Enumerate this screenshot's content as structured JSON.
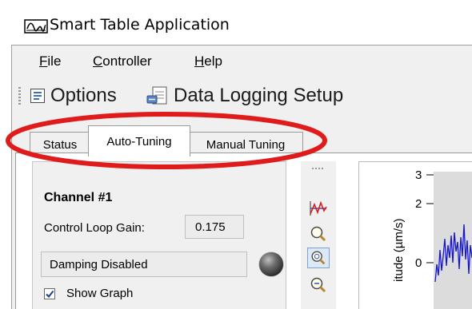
{
  "window": {
    "title": "Smart Table Application"
  },
  "menu": [
    {
      "mnemonic": "F",
      "rest": "ile"
    },
    {
      "mnemonic": "C",
      "rest": "ontroller"
    },
    {
      "mnemonic": "H",
      "rest": "elp"
    }
  ],
  "toolbar": {
    "options_label": "Options",
    "logging_label": "Data Logging Setup"
  },
  "tabs": [
    {
      "label": "Status"
    },
    {
      "label": "Auto-Tuning",
      "selected": true
    },
    {
      "label": "Manual Tuning"
    }
  ],
  "channel": {
    "title": "Channel #1",
    "gain_label": "Control Loop Gain:",
    "gain_value": "0.175",
    "damping_text": "Damping Disabled",
    "show_graph_label": "Show Graph",
    "show_graph_checked": true
  },
  "graph_tools": [
    "autoscale-icon",
    "zoom-icon",
    "zoom-selected-icon",
    "zoom-out-icon"
  ],
  "graph": {
    "ylabel": "itude (µm/s)",
    "y_ticks": [
      "3",
      "2",
      "0"
    ]
  },
  "colors": {
    "highlight_ellipse": "#e01b1b",
    "trace": "#1414d8",
    "plot_bg": "#dcdcdc"
  }
}
